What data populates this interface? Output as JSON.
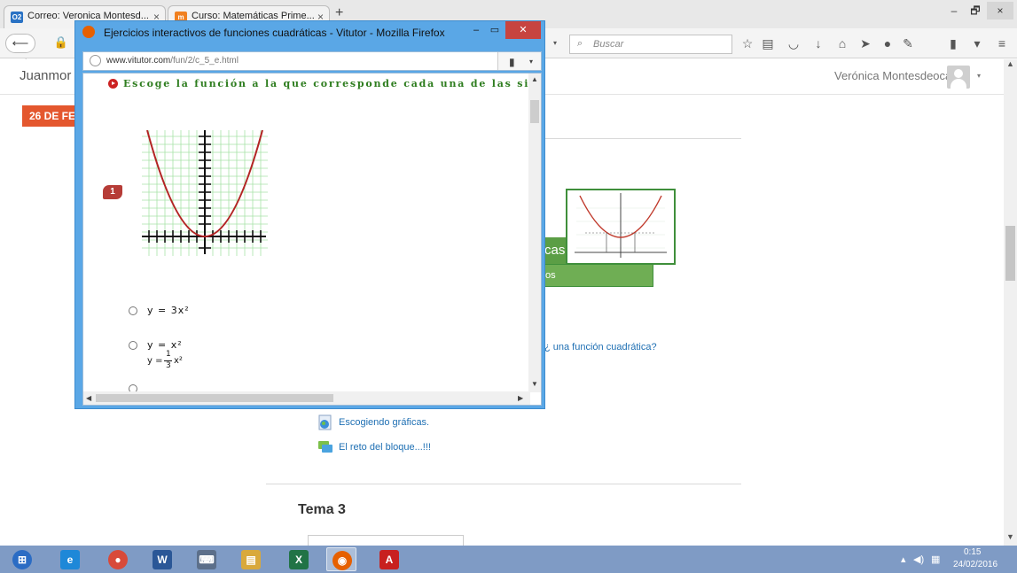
{
  "browser": {
    "tabs": [
      {
        "label": "Correo: Veronica Montesd...",
        "icon": "outlook-icon",
        "icon_color": "#2a72c4",
        "icon_text": "O2"
      },
      {
        "label": "Curso: Matemáticas Prime...",
        "icon": "moodle-icon",
        "icon_color": "#f08020",
        "icon_text": "m"
      }
    ],
    "tab_close": "×",
    "new_tab": "+",
    "window_controls": {
      "minimize": "–",
      "maximize": "🗗",
      "close": "×"
    },
    "search_placeholder": "Buscar",
    "toolbar_icons": [
      "star-icon",
      "reading-list-icon",
      "pocket-icon",
      "download-icon",
      "home-icon",
      "send-icon",
      "chat-icon",
      "extension-icon",
      "calculator-icon",
      "menu-icon"
    ]
  },
  "site": {
    "name": "Juanmor",
    "user": "Verónica Montesdeoca",
    "date_banner": "26 DE FE",
    "course_title_fragment": "cas",
    "course_sub_fragment": "os",
    "question_link": "¿ una función cuadrática?",
    "activities": [
      {
        "label": "Escogiendo gráficas.",
        "icon": "globe-activity-icon"
      },
      {
        "label": "El reto del bloque...!!!",
        "icon": "forum-icon"
      }
    ],
    "section_title": "Tema 3"
  },
  "popup": {
    "title": "Ejercicios interactivos de funciones cuadráticas - Vitutor - Mozilla Firefox",
    "url_domain": "www.vitutor.com",
    "url_path": "/fun/2/c_5_e.html",
    "question": "Escoge la función a la que corresponde cada una de las siguientes",
    "question_number": "1",
    "options": [
      {
        "text": "y  =  3x²"
      },
      {
        "text": "y  =  x²"
      }
    ],
    "option3": {
      "lhs": "y =",
      "num": "1",
      "den": "3",
      "rhs": "x²"
    },
    "controls": {
      "minimize": "–",
      "maximize": "▭",
      "close": "✕"
    }
  },
  "taskbar": {
    "apps": [
      {
        "name": "start-button",
        "color": "#2b6cc4",
        "glyph": "⊞"
      },
      {
        "name": "internet-explorer-icon",
        "color": "#1e88d8",
        "glyph": "e"
      },
      {
        "name": "chrome-icon",
        "color": "#d84a3a",
        "glyph": "●"
      },
      {
        "name": "word-icon",
        "color": "#2b5797",
        "glyph": "W"
      },
      {
        "name": "keyboard-icon",
        "color": "#5c6f8a",
        "glyph": "⌨"
      },
      {
        "name": "file-explorer-icon",
        "color": "#d9a93b",
        "glyph": "▤"
      },
      {
        "name": "excel-icon",
        "color": "#217346",
        "glyph": "X"
      },
      {
        "name": "firefox-icon",
        "color": "#e66000",
        "glyph": "◉"
      },
      {
        "name": "acrobat-icon",
        "color": "#c8201f",
        "glyph": "A"
      }
    ],
    "time": "0:15",
    "date": "24/02/2016"
  }
}
